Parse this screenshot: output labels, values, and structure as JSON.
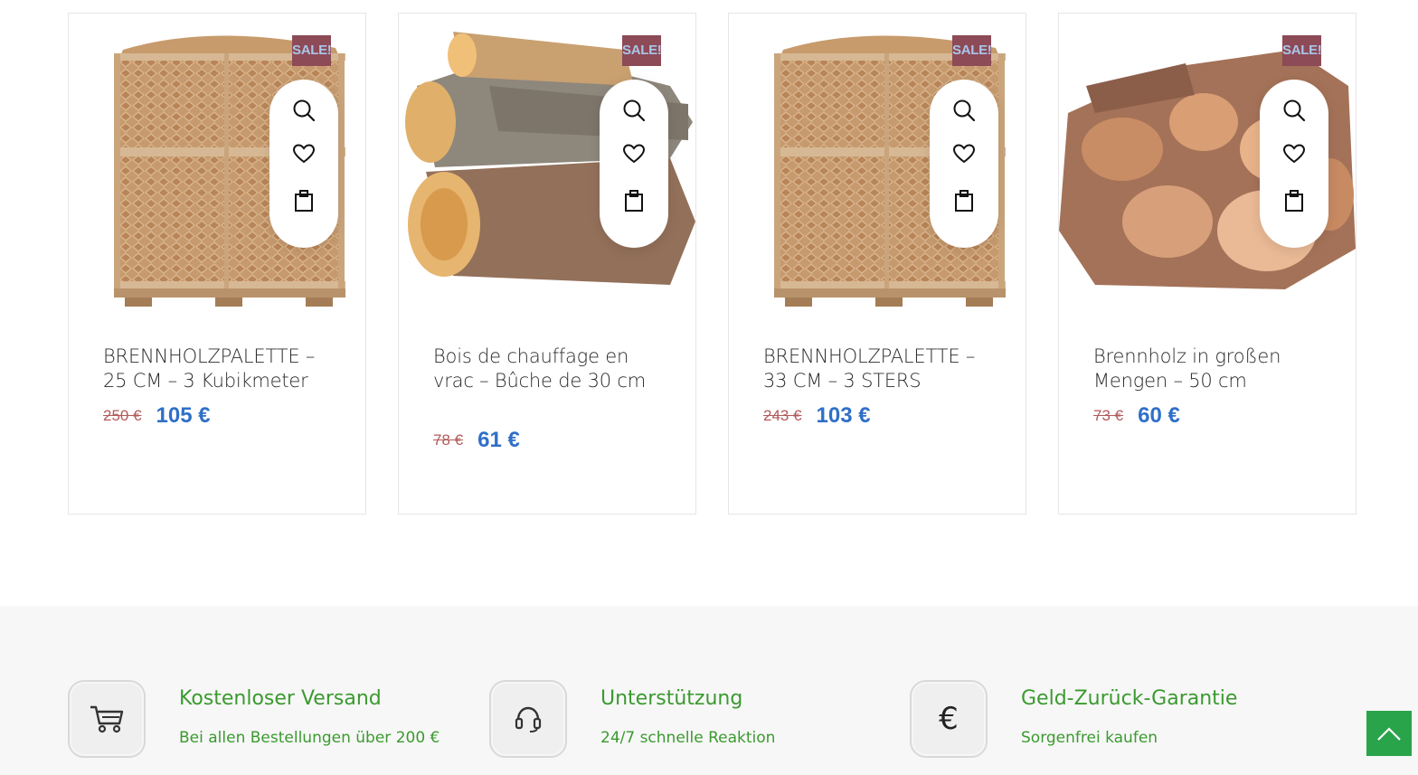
{
  "products": [
    {
      "image": "firewood-pallet-image",
      "badge": "SALE!",
      "title": "BRENNHOLZPALETTE – 25 CM – 3 Kubikmeter",
      "old_price": "250 €",
      "price": "105 €"
    },
    {
      "image": "firewood-logs-image",
      "badge": "SALE!",
      "title": "Bois de chauffage en vrac – Bûche de 30 cm",
      "old_price": "78 €",
      "price": "61 €"
    },
    {
      "image": "firewood-pallet-image",
      "badge": "SALE!",
      "title": "BRENNHOLZPALETTE – 33 CM – 3 STERS",
      "old_price": "243 €",
      "price": "103 €"
    },
    {
      "image": "firewood-pile-image",
      "badge": "SALE!",
      "title": "Brennholz in großen Mengen – 50 cm",
      "old_price": "73 €",
      "price": "60 €"
    }
  ],
  "product_actions": [
    "zoom-icon",
    "heart-icon",
    "cart-icon"
  ],
  "features": [
    {
      "icon": "shopping-cart-icon",
      "title": "Kostenloser Versand",
      "subtitle": "Bei allen Bestellungen über 200 €"
    },
    {
      "icon": "headset-icon",
      "title": "Unterstützung",
      "subtitle": "24/7 schnelle Reaktion"
    },
    {
      "icon": "euro-icon",
      "title": "Geld-Zurück-Garantie",
      "subtitle": "Sorgenfrei kaufen"
    }
  ],
  "colors": {
    "accent_green": "#3b9a2f",
    "price_blue": "#2f6fc8",
    "sale_badge": "#8d4a57",
    "old_price": "#b35a5a",
    "scroll_top": "#2aa44a"
  },
  "scroll_top_icon": "chevron-up-icon"
}
